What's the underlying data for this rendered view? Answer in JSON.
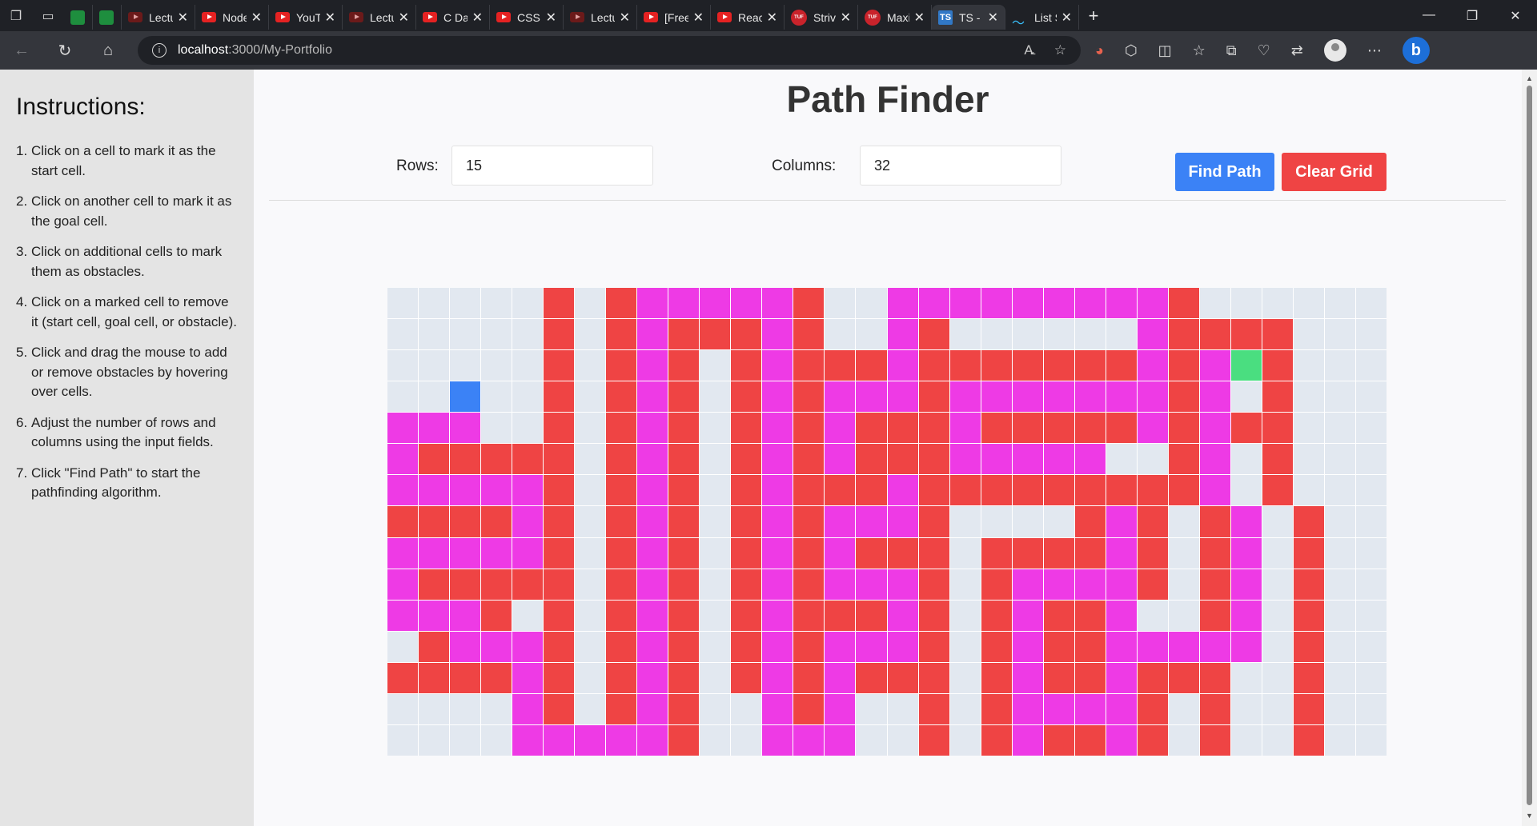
{
  "browser": {
    "tabs": [
      {
        "title": "",
        "icon": "sheets-icon"
      },
      {
        "title": "",
        "icon": "sheets-icon"
      },
      {
        "title": "Lectu",
        "icon": "youtube-dim-icon"
      },
      {
        "title": "Node",
        "icon": "youtube-icon"
      },
      {
        "title": "YouT",
        "icon": "youtube-icon"
      },
      {
        "title": "Lectu",
        "icon": "youtube-dim-icon"
      },
      {
        "title": "C Da",
        "icon": "youtube-icon"
      },
      {
        "title": "CSS T",
        "icon": "youtube-icon"
      },
      {
        "title": "Lectu",
        "icon": "youtube-dim-icon"
      },
      {
        "title": "[Free",
        "icon": "youtube-icon"
      },
      {
        "title": "React",
        "icon": "youtube-icon"
      },
      {
        "title": "Strive",
        "icon": "tuf-icon"
      },
      {
        "title": "Maxi",
        "icon": "tuf-icon"
      },
      {
        "title": "TS - I",
        "icon": "typescript-icon",
        "active": true
      },
      {
        "title": "List S",
        "icon": "tailwind-icon"
      }
    ],
    "url_host": "localhost",
    "url_path": ":3000/My-Portfolio"
  },
  "sidebar": {
    "heading": "Instructions:",
    "items": [
      {
        "num": "1.",
        "text": "Click on a cell to mark it as the start cell."
      },
      {
        "num": "2.",
        "text": "Click on another cell to mark it as the goal cell."
      },
      {
        "num": "3.",
        "text": "Click on additional cells to mark them as obstacles."
      },
      {
        "num": "4.",
        "text": "Click on a marked cell to remove it (start cell, goal cell, or obstacle)."
      },
      {
        "num": "5.",
        "text": "Click and drag the mouse to add or remove obstacles by hovering over cells."
      },
      {
        "num": "6.",
        "text": "Adjust the number of rows and columns using the input fields."
      },
      {
        "num": "7.",
        "text": "Click \"Find Path\" to start the pathfinding algorithm."
      }
    ]
  },
  "main": {
    "title": "Path Finder",
    "rows_label": "Rows:",
    "rows_value": "15",
    "columns_label": "Columns:",
    "columns_value": "32",
    "find_path_label": "Find Path",
    "clear_grid_label": "Clear Grid"
  },
  "colors": {
    "empty": "#e2e8f0",
    "obstacle": "#ef4444",
    "visited": "#ee3ae5",
    "start": "#3b82f6",
    "goal": "#4ade80",
    "find_button": "#3b82f6",
    "clear_button": "#ef4444"
  },
  "grid": {
    "rows": 15,
    "cols": 32,
    "legend": {
      "E": "empty",
      "O": "obstacle",
      "V": "visited",
      "S": "start",
      "G": "goal"
    },
    "cells": [
      "EEEEEOEOVVVVVOEEVVVVVVVVVOEEEEEE",
      "EEEEEOEOVOOOVOEEVOEEEEEEVOOOOEEE",
      "EEEEEOEOVOEOVOOOVOOOOOOOVOVGOEEE",
      "EESEEOEOVOEOVOVVVOVVVVVVVOVEOEEE",
      "VVVEEOEOVOEOVOVOOOVOOOOOVOVOOEEE",
      "VOOOOOEOVOEOVOVOOOVVVVVEEOVEOEEE",
      "VVVVVOEOVOEOVOOOVOOOOOOOOOVEOEEE",
      "OOOOVOEOVOEOVOVVVOEEEEOVOEOVEOEE",
      "VVVVVOEOVOEOVOVOOOEOOOOVOEOVEOEE",
      "VOOOOOEOVOEOVOVVVOEOVVVVOEOVEOEE",
      "VVVOEOEOVOEOVOOOVOEOVOOVEEOVEOEE",
      "EOVVVOEOVOEOVOVVVOEOVOOVVVVVEOEE",
      "OOOOVOEOVOEOVOVOOOEOVOOVOOOEEOEE",
      "EEEEVOEOVOEEVOVEEOEOVVVVOEOEEOEE",
      "EEEEVVVVVOEEVVVEEOEOVOOVOEOEEOEE"
    ]
  }
}
